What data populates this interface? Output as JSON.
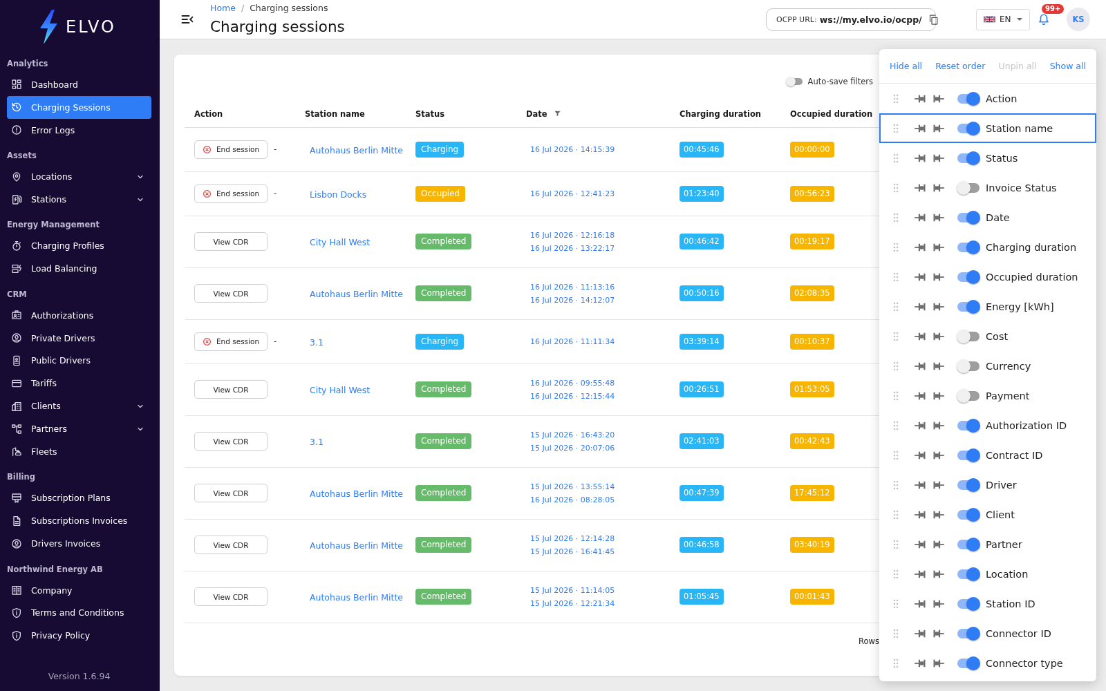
{
  "sidebar": {
    "logo": "ELVO",
    "sections": [
      {
        "label": "Analytics",
        "items": [
          {
            "label": "Dashboard",
            "kind": "link",
            "selected": false
          },
          {
            "label": "Charging Sessions",
            "kind": "link",
            "selected": true
          },
          {
            "label": "Error Logs",
            "kind": "link",
            "selected": false
          }
        ]
      },
      {
        "label": "Assets",
        "items": [
          {
            "label": "Locations",
            "kind": "group",
            "expanded": false,
            "selected": false
          },
          {
            "label": "Stations",
            "kind": "group",
            "expanded": false,
            "selected": false
          }
        ]
      },
      {
        "label": "Energy Management",
        "items": [
          {
            "label": "Charging Profiles",
            "kind": "link",
            "selected": false
          },
          {
            "label": "Load Balancing",
            "kind": "link",
            "selected": false
          }
        ]
      },
      {
        "label": "CRM",
        "items": [
          {
            "label": "Authorizations",
            "kind": "link",
            "selected": false
          },
          {
            "label": "Private Drivers",
            "kind": "link",
            "selected": false
          },
          {
            "label": "Public Drivers",
            "kind": "link",
            "selected": false
          },
          {
            "label": "Tariffs",
            "kind": "link",
            "selected": false
          },
          {
            "label": "Clients",
            "kind": "group",
            "expanded": false,
            "selected": false
          },
          {
            "label": "Partners",
            "kind": "group",
            "expanded": false,
            "selected": false
          },
          {
            "label": "Fleets",
            "kind": "link",
            "selected": false
          }
        ]
      },
      {
        "label": "Billing",
        "items": [
          {
            "label": "Subscription Plans",
            "kind": "link",
            "selected": false
          },
          {
            "label": "Subscriptions Invoices",
            "kind": "link",
            "selected": false
          },
          {
            "label": "Drivers Invoices",
            "kind": "link",
            "selected": false
          }
        ]
      },
      {
        "label": "Northwind Energy AB",
        "items": [
          {
            "label": "Company",
            "kind": "link",
            "selected": false
          },
          {
            "label": "Terms and Conditions",
            "kind": "link",
            "selected": false
          },
          {
            "label": "Privacy Policy",
            "kind": "link",
            "selected": false
          }
        ]
      }
    ],
    "version": "Version 1.6.94"
  },
  "header": {
    "breadcrumb": [
      "Home",
      "Charging sessions"
    ],
    "breadcrumb_separator": "/",
    "title": "Charging sessions",
    "ocpp": {
      "label": "OCPP URL:",
      "value": "ws://my.elvo.io/ocpp/"
    },
    "language": "EN",
    "notifications": "99+",
    "avatar": "KS"
  },
  "table": {
    "auto_save_filters": {
      "label": "Auto-save filters",
      "on": false
    },
    "columns": [
      {
        "label": "Action",
        "filter": false
      },
      {
        "label": "Station name",
        "filter": false
      },
      {
        "label": "Status",
        "filter": false
      },
      {
        "label": "Date",
        "filter": true
      },
      {
        "label": "Charging duration",
        "filter": false
      },
      {
        "label": "Occupied duration",
        "filter": false
      }
    ],
    "rows": [
      {
        "action": {
          "label": "End session",
          "kind": "end",
          "note": "-"
        },
        "station_name": "Autohaus Berlin Mitte",
        "status": {
          "label": "Charging",
          "color": "#29b6f6"
        },
        "date": [
          "16 Jul 2026 · 14:15:39"
        ],
        "charging_duration": "00:45:46",
        "occupied_duration": "00:00:00"
      },
      {
        "action": {
          "label": "End session",
          "kind": "end",
          "note": "-"
        },
        "station_name": "Lisbon Docks",
        "status": {
          "label": "Occupied",
          "color": "#f8b500"
        },
        "date": [
          "16 Jul 2026 · 12:41:23"
        ],
        "charging_duration": "01:23:40",
        "occupied_duration": "00:56:23"
      },
      {
        "action": {
          "label": "View CDR",
          "kind": "view"
        },
        "station_name": "City Hall West",
        "status": {
          "label": "Completed",
          "color": "#66bb6a"
        },
        "date": [
          "16 Jul 2026 · 12:16:18",
          "16 Jul 2026 · 13:22:17"
        ],
        "charging_duration": "00:46:42",
        "occupied_duration": "00:19:17"
      },
      {
        "action": {
          "label": "View CDR",
          "kind": "view"
        },
        "station_name": "Autohaus Berlin Mitte",
        "status": {
          "label": "Completed",
          "color": "#66bb6a"
        },
        "date": [
          "16 Jul 2026 · 11:13:16",
          "16 Jul 2026 · 14:12:07"
        ],
        "charging_duration": "00:50:16",
        "occupied_duration": "02:08:35"
      },
      {
        "action": {
          "label": "End session",
          "kind": "end",
          "note": "-"
        },
        "station_name": "3.1",
        "status": {
          "label": "Charging",
          "color": "#29b6f6"
        },
        "date": [
          "16 Jul 2026 · 11:11:34"
        ],
        "charging_duration": "03:39:14",
        "occupied_duration": "00:10:37"
      },
      {
        "action": {
          "label": "View CDR",
          "kind": "view"
        },
        "station_name": "City Hall West",
        "status": {
          "label": "Completed",
          "color": "#66bb6a"
        },
        "date": [
          "16 Jul 2026 · 09:55:48",
          "16 Jul 2026 · 12:15:44"
        ],
        "charging_duration": "00:26:51",
        "occupied_duration": "01:53:05"
      },
      {
        "action": {
          "label": "View CDR",
          "kind": "view"
        },
        "station_name": "3.1",
        "status": {
          "label": "Completed",
          "color": "#66bb6a"
        },
        "date": [
          "15 Jul 2026 · 16:43:20",
          "15 Jul 2026 · 20:07:06"
        ],
        "charging_duration": "02:41:03",
        "occupied_duration": "00:42:43"
      },
      {
        "action": {
          "label": "View CDR",
          "kind": "view"
        },
        "station_name": "Autohaus Berlin Mitte",
        "status": {
          "label": "Completed",
          "color": "#66bb6a"
        },
        "date": [
          "15 Jul 2026 · 13:55:14",
          "16 Jul 2026 · 08:28:05"
        ],
        "charging_duration": "00:47:39",
        "occupied_duration": "17:45:12"
      },
      {
        "action": {
          "label": "View CDR",
          "kind": "view"
        },
        "station_name": "Autohaus Berlin Mitte",
        "status": {
          "label": "Completed",
          "color": "#66bb6a"
        },
        "date": [
          "15 Jul 2026 · 12:14:28",
          "15 Jul 2026 · 16:41:45"
        ],
        "charging_duration": "00:46:58",
        "occupied_duration": "03:40:19"
      },
      {
        "action": {
          "label": "View CDR",
          "kind": "view"
        },
        "station_name": "Autohaus Berlin Mitte",
        "status": {
          "label": "Completed",
          "color": "#66bb6a"
        },
        "date": [
          "15 Jul 2026 · 11:14:05",
          "15 Jul 2026 · 12:21:34"
        ],
        "charging_duration": "01:05:45",
        "occupied_duration": "00:01:43"
      }
    ],
    "footer_label": "Rows"
  },
  "column_panel": {
    "actions": [
      {
        "label": "Hide all",
        "disabled": false
      },
      {
        "label": "Reset order",
        "disabled": false
      },
      {
        "label": "Unpin all",
        "disabled": true
      },
      {
        "label": "Show all",
        "disabled": false
      }
    ],
    "columns": [
      {
        "label": "Action",
        "visible": true,
        "selected": false
      },
      {
        "label": "Station name",
        "visible": true,
        "selected": true
      },
      {
        "label": "Status",
        "visible": true,
        "selected": false
      },
      {
        "label": "Invoice Status",
        "visible": false,
        "selected": false
      },
      {
        "label": "Date",
        "visible": true,
        "selected": false
      },
      {
        "label": "Charging duration",
        "visible": true,
        "selected": false
      },
      {
        "label": "Occupied duration",
        "visible": true,
        "selected": false
      },
      {
        "label": "Energy [kWh]",
        "visible": true,
        "selected": false
      },
      {
        "label": "Cost",
        "visible": false,
        "selected": false
      },
      {
        "label": "Currency",
        "visible": false,
        "selected": false
      },
      {
        "label": "Payment",
        "visible": false,
        "selected": false
      },
      {
        "label": "Authorization ID",
        "visible": true,
        "selected": false
      },
      {
        "label": "Contract ID",
        "visible": true,
        "selected": false
      },
      {
        "label": "Driver",
        "visible": true,
        "selected": false
      },
      {
        "label": "Client",
        "visible": true,
        "selected": false
      },
      {
        "label": "Partner",
        "visible": true,
        "selected": false
      },
      {
        "label": "Location",
        "visible": true,
        "selected": false
      },
      {
        "label": "Station ID",
        "visible": true,
        "selected": false
      },
      {
        "label": "Connector ID",
        "visible": true,
        "selected": false
      },
      {
        "label": "Connector type",
        "visible": true,
        "selected": false
      }
    ]
  }
}
